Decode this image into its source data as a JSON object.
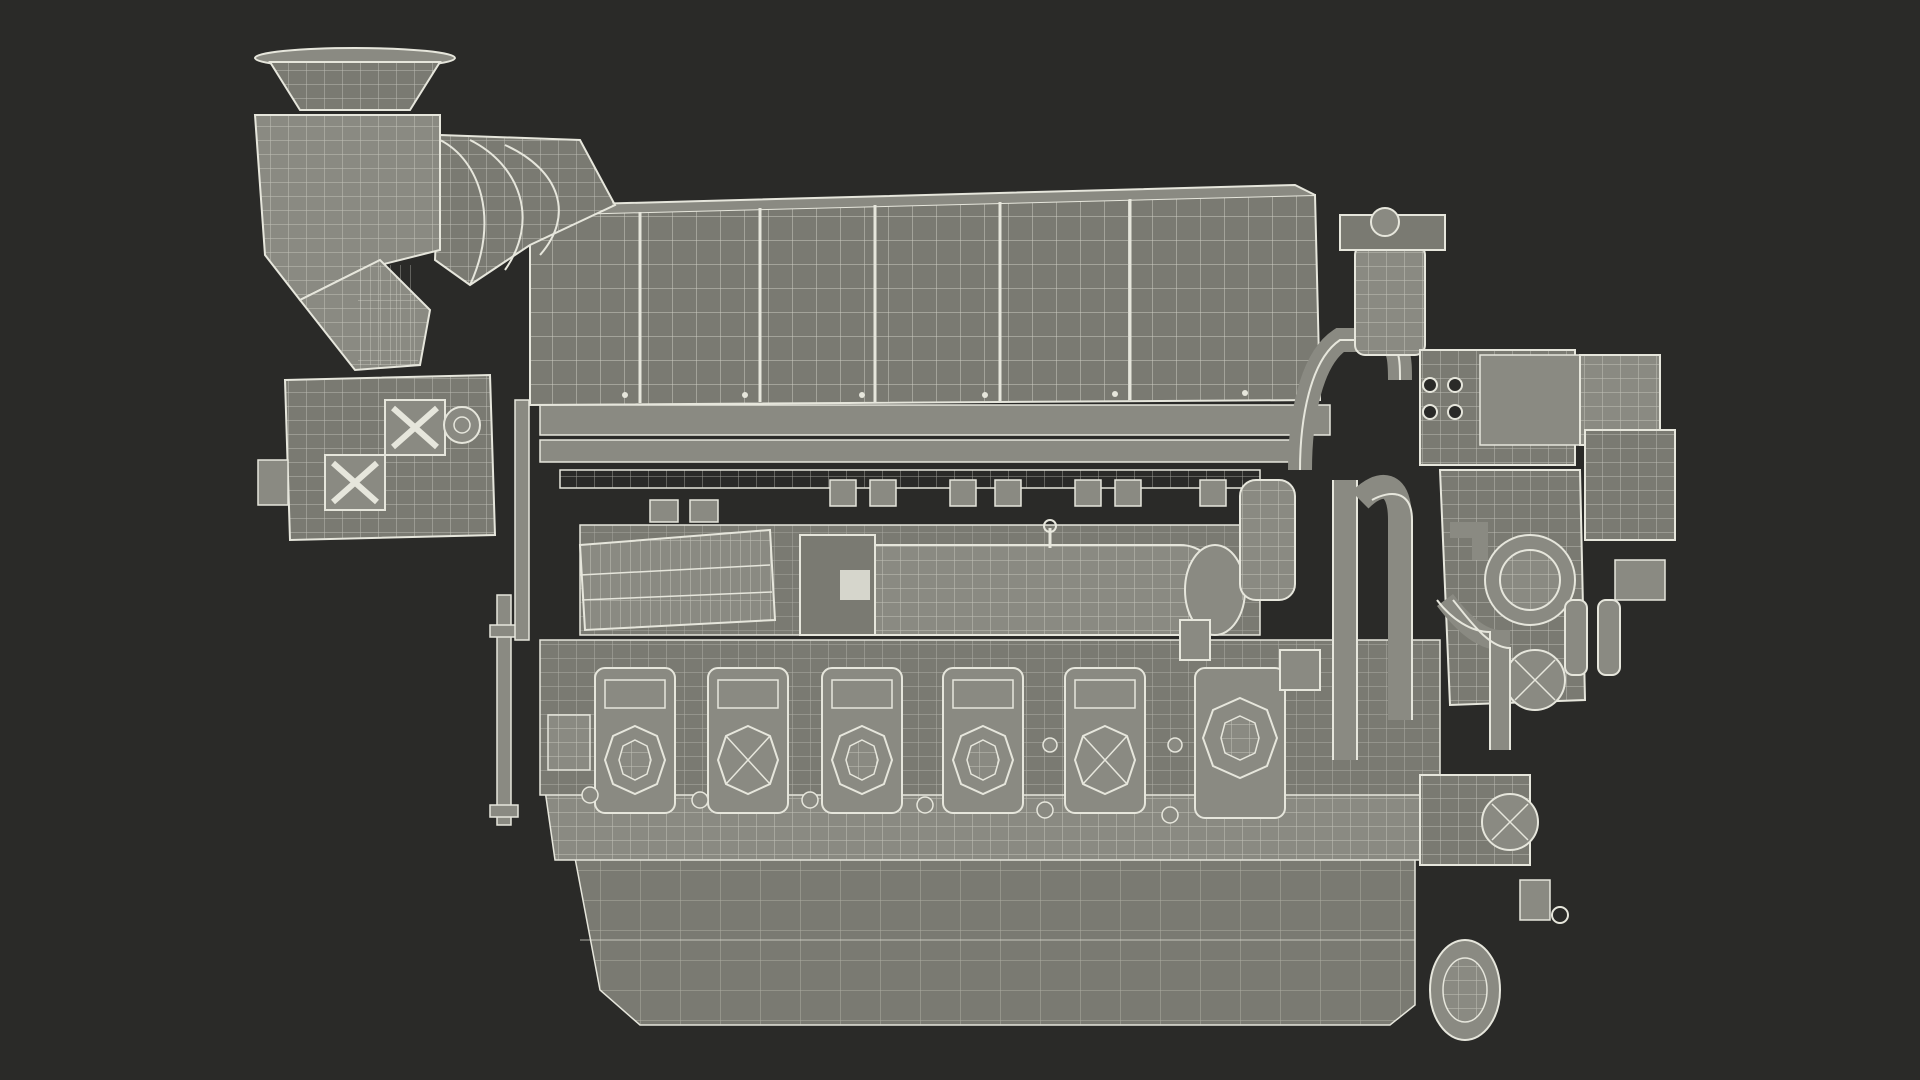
{
  "scene": {
    "background": "#2a2a28",
    "fill": "#7a7a72",
    "fill_dark": "#66665f",
    "fill_light": "#8a8a82",
    "wire": "#e6e6dc",
    "wire_faint": "#bdbdb2",
    "subject_icon": "marine-diesel-engine-wireframe"
  }
}
